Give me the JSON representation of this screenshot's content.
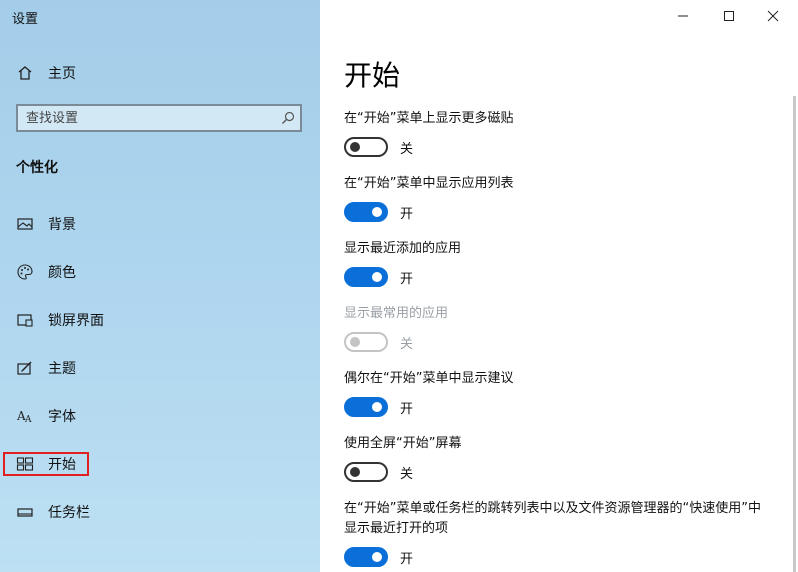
{
  "app": {
    "title": "设置"
  },
  "window_controls": {
    "minimize": "—",
    "maximize": "☐",
    "close": "✕"
  },
  "sidebar": {
    "home_label": "主页",
    "search_placeholder": "查找设置",
    "section_heading": "个性化",
    "items": [
      {
        "label": "背景",
        "icon": "image-icon"
      },
      {
        "label": "颜色",
        "icon": "palette-icon"
      },
      {
        "label": "锁屏界面",
        "icon": "lock-screen-icon"
      },
      {
        "label": "主题",
        "icon": "theme-icon"
      },
      {
        "label": "字体",
        "icon": "font-icon"
      },
      {
        "label": "开始",
        "icon": "start-icon",
        "selected": true
      },
      {
        "label": "任务栏",
        "icon": "taskbar-icon"
      }
    ]
  },
  "main": {
    "title": "开始",
    "settings": [
      {
        "label": "在“开始”菜单上显示更多磁贴",
        "state": "关",
        "on": false,
        "disabled": false
      },
      {
        "label": "在“开始”菜单中显示应用列表",
        "state": "开",
        "on": true,
        "disabled": false
      },
      {
        "label": "显示最近添加的应用",
        "state": "开",
        "on": true,
        "disabled": false
      },
      {
        "label": "显示最常用的应用",
        "state": "关",
        "on": false,
        "disabled": true
      },
      {
        "label": "偶尔在“开始”菜单中显示建议",
        "state": "开",
        "on": true,
        "disabled": false
      },
      {
        "label": "使用全屏“开始”屏幕",
        "state": "关",
        "on": false,
        "disabled": false
      },
      {
        "label": "在“开始”菜单或任务栏的跳转列表中以及文件资源管理器的“快速使用”中显示最近打开的项",
        "state": "开",
        "on": true,
        "disabled": false
      }
    ]
  },
  "colors": {
    "accent": "#0a6fd8",
    "highlight": "#e02020"
  }
}
